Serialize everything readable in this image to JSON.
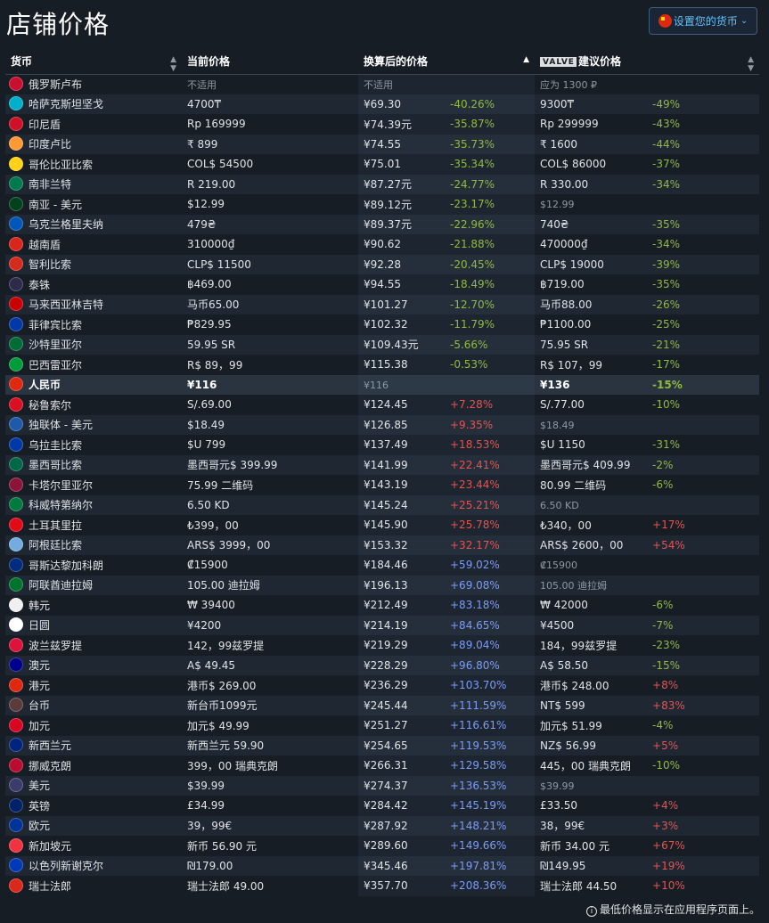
{
  "page": {
    "title": "店铺价格"
  },
  "currency_button": {
    "label": "设置您的货币"
  },
  "table": {
    "headers": {
      "currency": "货币",
      "current_price": "当前价格",
      "converted_price": "换算后的价格",
      "valve_logo": "VALVE",
      "suggested_price": "建议价格"
    },
    "rows": [
      {
        "name": "俄罗斯卢布",
        "flag": "#c8102e",
        "current": "不适用",
        "converted": "不适用",
        "conv_diff": "",
        "conv_diff_class": "",
        "suggested": "应为 1300 ₽",
        "sugg_diff": "",
        "sugg_diff_class": "",
        "current_muted": true,
        "converted_muted": true,
        "suggested_muted": true
      },
      {
        "name": "哈萨克斯坦坚戈",
        "flag": "#00afca",
        "current": "4700₸",
        "converted": "¥69.30",
        "conv_diff": "-40.26%",
        "conv_diff_class": "neg",
        "suggested": "9300₸",
        "sugg_diff": "-49%",
        "sugg_diff_class": "neg"
      },
      {
        "name": "印尼盾",
        "flag": "#ce1126",
        "current": "Rp 169999",
        "converted": "¥74.39元",
        "conv_diff": "-35.87%",
        "conv_diff_class": "neg",
        "suggested": "Rp 299999",
        "sugg_diff": "-43%",
        "sugg_diff_class": "neg"
      },
      {
        "name": "印度卢比",
        "flag": "#ff9933",
        "current": "₹ 899",
        "converted": "¥74.55",
        "conv_diff": "-35.73%",
        "conv_diff_class": "neg",
        "suggested": "₹ 1600",
        "sugg_diff": "-44%",
        "sugg_diff_class": "neg"
      },
      {
        "name": "哥伦比亚比索",
        "flag": "#fcd116",
        "current": "COL$ 54500",
        "converted": "¥75.01",
        "conv_diff": "-35.34%",
        "conv_diff_class": "neg",
        "suggested": "COL$ 86000",
        "sugg_diff": "-37%",
        "sugg_diff_class": "neg"
      },
      {
        "name": "南非兰特",
        "flag": "#007a4d",
        "current": "R 219.00",
        "converted": "¥87.27元",
        "conv_diff": "-24.77%",
        "conv_diff_class": "neg",
        "suggested": "R 330.00",
        "sugg_diff": "-34%",
        "sugg_diff_class": "neg"
      },
      {
        "name": "南亚 - 美元",
        "flag": "#01411c",
        "current": "$12.99",
        "converted": "¥89.12元",
        "conv_diff": "-23.17%",
        "conv_diff_class": "neg",
        "suggested": "$12.99",
        "sugg_diff": "",
        "sugg_diff_class": "",
        "suggested_muted": true
      },
      {
        "name": "乌克兰格里夫纳",
        "flag": "#0057b7",
        "current": "479₴",
        "converted": "¥89.37元",
        "conv_diff": "-22.96%",
        "conv_diff_class": "neg",
        "suggested": "740₴",
        "sugg_diff": "-35%",
        "sugg_diff_class": "neg"
      },
      {
        "name": "越南盾",
        "flag": "#da251d",
        "current": "310000₫",
        "converted": "¥90.62",
        "conv_diff": "-21.88%",
        "conv_diff_class": "neg",
        "suggested": "470000₫",
        "sugg_diff": "-34%",
        "sugg_diff_class": "neg"
      },
      {
        "name": "智利比索",
        "flag": "#d52b1e",
        "current": "CLP$ 11500",
        "converted": "¥92.28",
        "conv_diff": "-20.45%",
        "conv_diff_class": "neg",
        "suggested": "CLP$ 19000",
        "sugg_diff": "-39%",
        "sugg_diff_class": "neg"
      },
      {
        "name": "泰铢",
        "flag": "#2d2a4a",
        "current": "฿469.00",
        "converted": "¥94.55",
        "conv_diff": "-18.49%",
        "conv_diff_class": "neg",
        "suggested": "฿719.00",
        "sugg_diff": "-35%",
        "sugg_diff_class": "neg"
      },
      {
        "name": "马来西亚林吉特",
        "flag": "#cc0001",
        "current": "马币65.00",
        "converted": "¥101.27",
        "conv_diff": "-12.70%",
        "conv_diff_class": "neg",
        "suggested": "马币88.00",
        "sugg_diff": "-26%",
        "sugg_diff_class": "neg"
      },
      {
        "name": "菲律宾比索",
        "flag": "#0038a8",
        "current": "₱829.95",
        "converted": "¥102.32",
        "conv_diff": "-11.79%",
        "conv_diff_class": "neg",
        "suggested": "₱1100.00",
        "sugg_diff": "-25%",
        "sugg_diff_class": "neg"
      },
      {
        "name": "沙特里亚尔",
        "flag": "#006c35",
        "current": "59.95 SR",
        "converted": "¥109.43元",
        "conv_diff": "-5.66%",
        "conv_diff_class": "neg",
        "suggested": "75.95 SR",
        "sugg_diff": "-21%",
        "sugg_diff_class": "neg"
      },
      {
        "name": "巴西雷亚尔",
        "flag": "#009c3b",
        "current": "R$ 89，99",
        "converted": "¥115.38",
        "conv_diff": "-0.53%",
        "conv_diff_class": "neg",
        "suggested": "R$ 107，99",
        "sugg_diff": "-17%",
        "sugg_diff_class": "neg"
      },
      {
        "name": "人民币",
        "flag": "#de2910",
        "current": "¥116",
        "converted": "¥116",
        "conv_diff": "",
        "conv_diff_class": "",
        "suggested": "¥136",
        "sugg_diff": "-15%",
        "sugg_diff_class": "neg",
        "highlight": true,
        "converted_muted": true
      },
      {
        "name": "秘鲁索尔",
        "flag": "#d91023",
        "current": "S/.69.00",
        "converted": "¥124.45",
        "conv_diff": "+7.28%",
        "conv_diff_class": "pos",
        "suggested": "S/.77.00",
        "sugg_diff": "-10%",
        "sugg_diff_class": "neg"
      },
      {
        "name": "独联体 - 美元",
        "flag": "#1e5aa8",
        "current": "$18.49",
        "converted": "¥126.85",
        "conv_diff": "+9.35%",
        "conv_diff_class": "pos",
        "suggested": "$18.49",
        "sugg_diff": "",
        "sugg_diff_class": "",
        "suggested_muted": true
      },
      {
        "name": "乌拉圭比索",
        "flag": "#0038a8",
        "current": "$U 799",
        "converted": "¥137.49",
        "conv_diff": "+18.53%",
        "conv_diff_class": "pos",
        "suggested": "$U 1150",
        "sugg_diff": "-31%",
        "sugg_diff_class": "neg"
      },
      {
        "name": "墨西哥比索",
        "flag": "#006847",
        "current": "墨西哥元$ 399.99",
        "converted": "¥141.99",
        "conv_diff": "+22.41%",
        "conv_diff_class": "pos",
        "suggested": "墨西哥元$ 409.99",
        "sugg_diff": "-2%",
        "sugg_diff_class": "neg"
      },
      {
        "name": "卡塔尔里亚尔",
        "flag": "#8a1538",
        "current": "75.99 二维码",
        "converted": "¥143.19",
        "conv_diff": "+23.44%",
        "conv_diff_class": "pos",
        "suggested": "80.99 二维码",
        "sugg_diff": "-6%",
        "sugg_diff_class": "neg"
      },
      {
        "name": "科威特第纳尔",
        "flag": "#007a3d",
        "current": "6.50 KD",
        "converted": "¥145.24",
        "conv_diff": "+25.21%",
        "conv_diff_class": "pos",
        "suggested": "6.50 KD",
        "sugg_diff": "",
        "sugg_diff_class": "",
        "suggested_muted": true
      },
      {
        "name": "土耳其里拉",
        "flag": "#e30a17",
        "current": "₺399，00",
        "converted": "¥145.90",
        "conv_diff": "+25.78%",
        "conv_diff_class": "pos",
        "suggested": "₺340，00",
        "sugg_diff": "+17%",
        "sugg_diff_class": "pos"
      },
      {
        "name": "阿根廷比索",
        "flag": "#74acdf",
        "current": "ARS$ 3999，00",
        "converted": "¥153.32",
        "conv_diff": "+32.17%",
        "conv_diff_class": "pos",
        "suggested": "ARS$ 2600，00",
        "sugg_diff": "+54%",
        "sugg_diff_class": "pos"
      },
      {
        "name": "哥斯达黎加科朗",
        "flag": "#002b7f",
        "current": "₡15900",
        "converted": "¥184.46",
        "conv_diff": "+59.02%",
        "conv_diff_class": "posb",
        "suggested": "₡15900",
        "sugg_diff": "",
        "sugg_diff_class": "",
        "suggested_muted": true
      },
      {
        "name": "阿联酋迪拉姆",
        "flag": "#00732f",
        "current": "105.00 迪拉姆",
        "converted": "¥196.13",
        "conv_diff": "+69.08%",
        "conv_diff_class": "posb",
        "suggested": "105.00 迪拉姆",
        "sugg_diff": "",
        "sugg_diff_class": "",
        "suggested_muted": true
      },
      {
        "name": "韩元",
        "flag": "#f0f0f0",
        "current": "₩ 39400",
        "converted": "¥212.49",
        "conv_diff": "+83.18%",
        "conv_diff_class": "posb",
        "suggested": "₩ 42000",
        "sugg_diff": "-6%",
        "sugg_diff_class": "neg"
      },
      {
        "name": "日圆",
        "flag": "#ffffff",
        "current": "¥4200",
        "converted": "¥214.19",
        "conv_diff": "+84.65%",
        "conv_diff_class": "posb",
        "suggested": "¥4500",
        "sugg_diff": "-7%",
        "sugg_diff_class": "neg"
      },
      {
        "name": "波兰兹罗提",
        "flag": "#dc143c",
        "current": "142，99兹罗提",
        "converted": "¥219.29",
        "conv_diff": "+89.04%",
        "conv_diff_class": "posb",
        "suggested": "184，99兹罗提",
        "sugg_diff": "-23%",
        "sugg_diff_class": "neg"
      },
      {
        "name": "澳元",
        "flag": "#00008b",
        "current": "A$ 49.45",
        "converted": "¥228.29",
        "conv_diff": "+96.80%",
        "conv_diff_class": "posb",
        "suggested": "A$ 58.50",
        "sugg_diff": "-15%",
        "sugg_diff_class": "neg"
      },
      {
        "name": "港元",
        "flag": "#de2910",
        "current": "港币$ 269.00",
        "converted": "¥236.29",
        "conv_diff": "+103.70%",
        "conv_diff_class": "posb",
        "suggested": "港币$ 248.00",
        "sugg_diff": "+8%",
        "sugg_diff_class": "pos"
      },
      {
        "name": "台币",
        "flag": "#5a3a3a",
        "current": "新台币1099元",
        "converted": "¥245.44",
        "conv_diff": "+111.59%",
        "conv_diff_class": "posb",
        "suggested": "NT$ 599",
        "sugg_diff": "+83%",
        "sugg_diff_class": "pos"
      },
      {
        "name": "加元",
        "flag": "#d80621",
        "current": "加元$ 49.99",
        "converted": "¥251.27",
        "conv_diff": "+116.61%",
        "conv_diff_class": "posb",
        "suggested": "加元$ 51.99",
        "sugg_diff": "-4%",
        "sugg_diff_class": "neg"
      },
      {
        "name": "新西兰元",
        "flag": "#00247d",
        "current": "新西兰元 59.90",
        "converted": "¥254.65",
        "conv_diff": "+119.53%",
        "conv_diff_class": "posb",
        "suggested": "NZ$ 56.99",
        "sugg_diff": "+5%",
        "sugg_diff_class": "pos"
      },
      {
        "name": "挪威克朗",
        "flag": "#ba0c2f",
        "current": "399，00 瑞典克朗",
        "converted": "¥266.31",
        "conv_diff": "+129.58%",
        "conv_diff_class": "posb",
        "suggested": "445，00 瑞典克朗",
        "sugg_diff": "-10%",
        "sugg_diff_class": "neg"
      },
      {
        "name": "美元",
        "flag": "#3c3b6e",
        "current": "$39.99",
        "converted": "¥274.37",
        "conv_diff": "+136.53%",
        "conv_diff_class": "posb",
        "suggested": "$39.99",
        "sugg_diff": "",
        "sugg_diff_class": "",
        "suggested_muted": true
      },
      {
        "name": "英镑",
        "flag": "#012169",
        "current": "£34.99",
        "converted": "¥284.42",
        "conv_diff": "+145.19%",
        "conv_diff_class": "posb",
        "suggested": "£33.50",
        "sugg_diff": "+4%",
        "sugg_diff_class": "pos"
      },
      {
        "name": "欧元",
        "flag": "#003399",
        "current": "39，99€",
        "converted": "¥287.92",
        "conv_diff": "+148.21%",
        "conv_diff_class": "posb",
        "suggested": "38，99€",
        "sugg_diff": "+3%",
        "sugg_diff_class": "pos"
      },
      {
        "name": "新加坡元",
        "flag": "#ef3340",
        "current": "新币 56.90 元",
        "converted": "¥289.60",
        "conv_diff": "+149.66%",
        "conv_diff_class": "posb",
        "suggested": "新币 34.00 元",
        "sugg_diff": "+67%",
        "sugg_diff_class": "pos"
      },
      {
        "name": "以色列新谢克尔",
        "flag": "#0038b8",
        "current": "₪179.00",
        "converted": "¥345.46",
        "conv_diff": "+197.81%",
        "conv_diff_class": "posb",
        "suggested": "₪149.95",
        "sugg_diff": "+19%",
        "sugg_diff_class": "pos"
      },
      {
        "name": "瑞士法郎",
        "flag": "#da291c",
        "current": "瑞士法郎 49.00",
        "converted": "¥357.70",
        "conv_diff": "+208.36%",
        "conv_diff_class": "posb",
        "suggested": "瑞士法郎 44.50",
        "sugg_diff": "+10%",
        "sugg_diff_class": "pos"
      }
    ]
  },
  "footer": {
    "note": "最低价格显示在应用程序页面上。",
    "info_glyph": "i"
  },
  "colors": {
    "background": "#171d25",
    "negative": "#90ba3c",
    "positive": "#e6524f",
    "positive_large": "#7d9bf5",
    "accent": "#66c0f4"
  }
}
